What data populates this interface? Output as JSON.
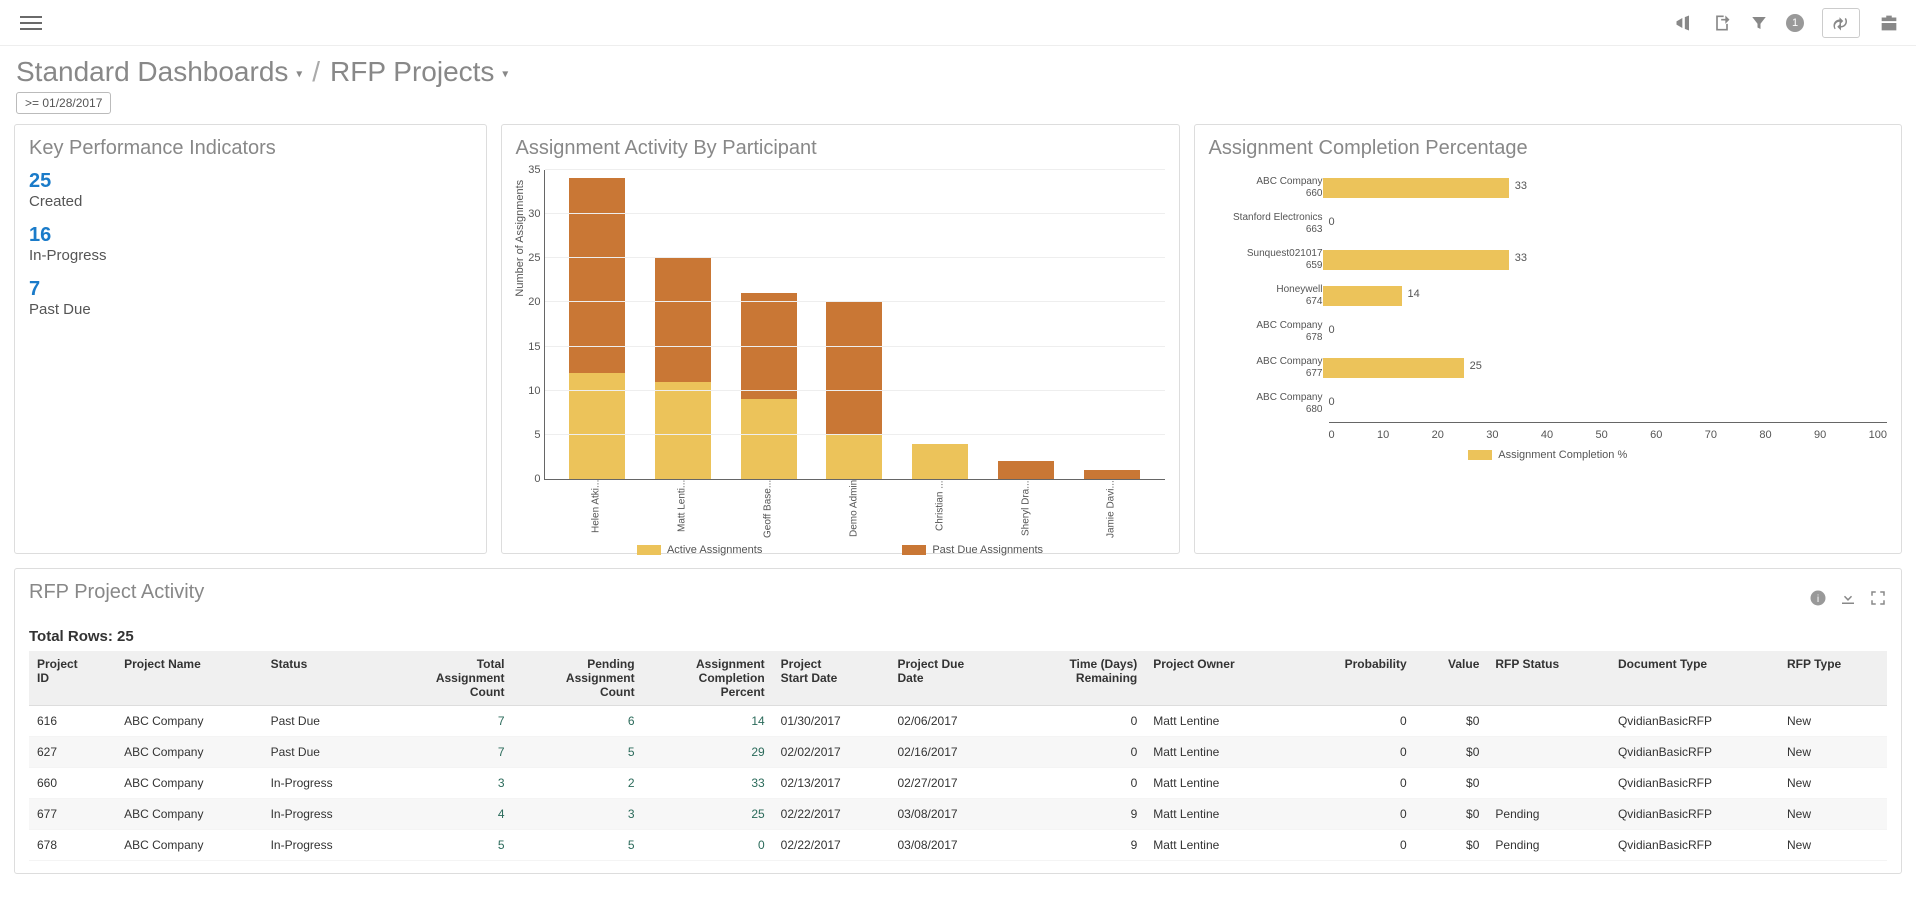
{
  "topbar": {
    "filter_count": "1"
  },
  "breadcrumb": {
    "level1": "Standard Dashboards",
    "level2": "RFP Projects"
  },
  "filter_chip": ">= 01/28/2017",
  "kpi": {
    "title": "Key Performance Indicators",
    "items": [
      {
        "value": "25",
        "label": "Created"
      },
      {
        "value": "16",
        "label": "In-Progress"
      },
      {
        "value": "7",
        "label": "Past Due"
      }
    ]
  },
  "chart_data": [
    {
      "type": "bar",
      "id": "assignment_activity",
      "title": "Assignment Activity By Participant",
      "ylabel": "Number of Assignments",
      "ylim": [
        0,
        35
      ],
      "yticks": [
        0,
        5,
        10,
        15,
        20,
        25,
        30,
        35
      ],
      "categories": [
        "Helen Atki...",
        "Matt Lenti...",
        "Geoff Base...",
        "Demo Admin",
        "Christian ...",
        "Sheryl Dra...",
        "Jamie Davi..."
      ],
      "series": [
        {
          "name": "Active Assignments",
          "color": "#ecc35a",
          "values": [
            12,
            11,
            9,
            5,
            4,
            0,
            0
          ]
        },
        {
          "name": "Past Due Assignments",
          "color": "#c97735",
          "values": [
            22,
            14,
            12,
            15,
            0,
            2,
            1
          ]
        }
      ]
    },
    {
      "type": "bar",
      "orientation": "horizontal",
      "id": "completion_pct",
      "title": "Assignment Completion Percentage",
      "xlim": [
        0,
        100
      ],
      "xticks": [
        0,
        10,
        20,
        30,
        40,
        50,
        60,
        70,
        80,
        90,
        100
      ],
      "categories": [
        "ABC Company 660",
        "Stanford Electronics 663",
        "Sunquest021017 659",
        "Honeywell 674",
        "ABC Company 678",
        "ABC Company 677",
        "ABC Company 680"
      ],
      "series": [
        {
          "name": "Assignment Completion %",
          "color": "#ecc35a",
          "values": [
            33,
            0,
            33,
            14,
            0,
            25,
            0
          ]
        }
      ]
    }
  ],
  "table": {
    "title": "RFP Project Activity",
    "total_rows_label": "Total Rows: 25",
    "columns": [
      "Project ID",
      "Project Name",
      "Status",
      "Total Assignment Count",
      "Pending Assignment Count",
      "Assignment Completion Percent",
      "Project Start Date",
      "Project Due Date",
      "Time (Days) Remaining",
      "Project Owner",
      "Probability",
      "Value",
      "RFP Status",
      "Document Type",
      "RFP Type"
    ],
    "rows": [
      {
        "id": "616",
        "name": "ABC Company",
        "status": "Past Due",
        "total": "7",
        "pending": "6",
        "pct": "14",
        "start": "01/30/2017",
        "due": "02/06/2017",
        "remain": "0",
        "owner": "Matt Lentine",
        "prob": "0",
        "value": "$0",
        "rfp_status": "",
        "doc": "QvidianBasicRFP",
        "type": "New"
      },
      {
        "id": "627",
        "name": "ABC Company",
        "status": "Past Due",
        "total": "7",
        "pending": "5",
        "pct": "29",
        "start": "02/02/2017",
        "due": "02/16/2017",
        "remain": "0",
        "owner": "Matt Lentine",
        "prob": "0",
        "value": "$0",
        "rfp_status": "",
        "doc": "QvidianBasicRFP",
        "type": "New"
      },
      {
        "id": "660",
        "name": "ABC Company",
        "status": "In-Progress",
        "total": "3",
        "pending": "2",
        "pct": "33",
        "start": "02/13/2017",
        "due": "02/27/2017",
        "remain": "0",
        "owner": "Matt Lentine",
        "prob": "0",
        "value": "$0",
        "rfp_status": "",
        "doc": "QvidianBasicRFP",
        "type": "New"
      },
      {
        "id": "677",
        "name": "ABC Company",
        "status": "In-Progress",
        "total": "4",
        "pending": "3",
        "pct": "25",
        "start": "02/22/2017",
        "due": "03/08/2017",
        "remain": "9",
        "owner": "Matt Lentine",
        "prob": "0",
        "value": "$0",
        "rfp_status": "Pending",
        "doc": "QvidianBasicRFP",
        "type": "New"
      },
      {
        "id": "678",
        "name": "ABC Company",
        "status": "In-Progress",
        "total": "5",
        "pending": "5",
        "pct": "0",
        "start": "02/22/2017",
        "due": "03/08/2017",
        "remain": "9",
        "owner": "Matt Lentine",
        "prob": "0",
        "value": "$0",
        "rfp_status": "Pending",
        "doc": "QvidianBasicRFP",
        "type": "New"
      }
    ]
  }
}
